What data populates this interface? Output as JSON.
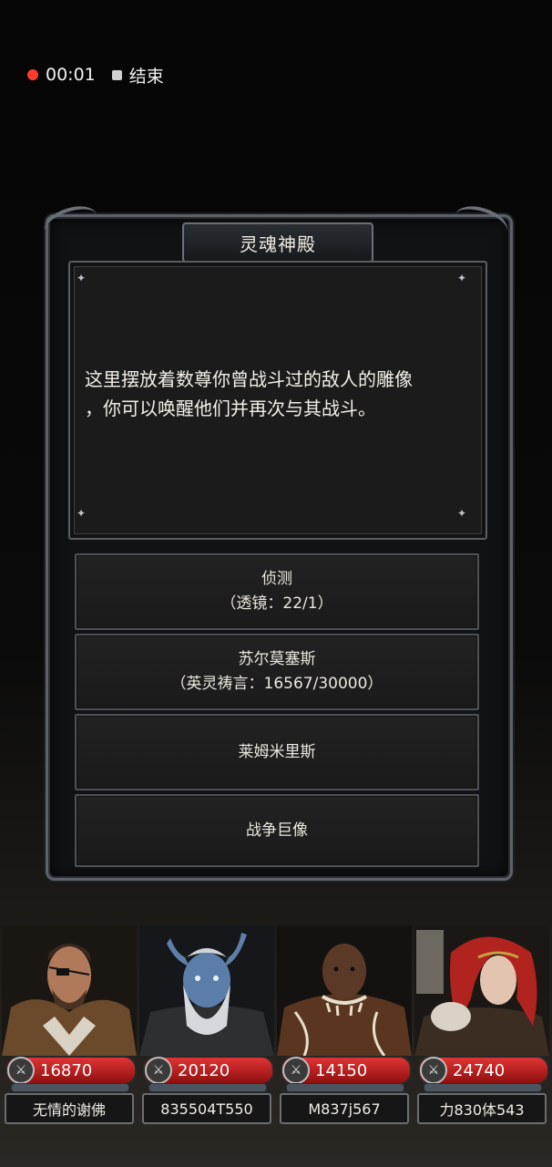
{
  "recording": {
    "time": "00:01",
    "stop_label": "结束"
  },
  "dialog": {
    "title": "灵魂神殿",
    "description_line1": "这里摆放着数尊你曾战斗过的敌人的雕像",
    "description_line2": "，你可以唤醒他们并再次与其战斗。",
    "options": [
      {
        "label": "侦测",
        "sub": "（透镜：22/1）"
      },
      {
        "label": "苏尔莫塞斯",
        "sub": "（英灵祷言：16567/30000）"
      },
      {
        "label": "莱姆米里斯",
        "sub": ""
      },
      {
        "label": "战争巨像",
        "sub": ""
      }
    ]
  },
  "heroes": [
    {
      "hp": "16870",
      "name": "无情的谢佛",
      "icon": "sword-icon"
    },
    {
      "hp": "20120",
      "name": "835504T550",
      "icon": "sword-icon"
    },
    {
      "hp": "14150",
      "name": "M837j567",
      "icon": "sword-icon"
    },
    {
      "hp": "24740",
      "name": "力830体543",
      "icon": "sword-icon"
    }
  ],
  "colors": {
    "accent": "#ff3b30",
    "hp_bar": "#c62222",
    "frame": "#5d6168"
  }
}
